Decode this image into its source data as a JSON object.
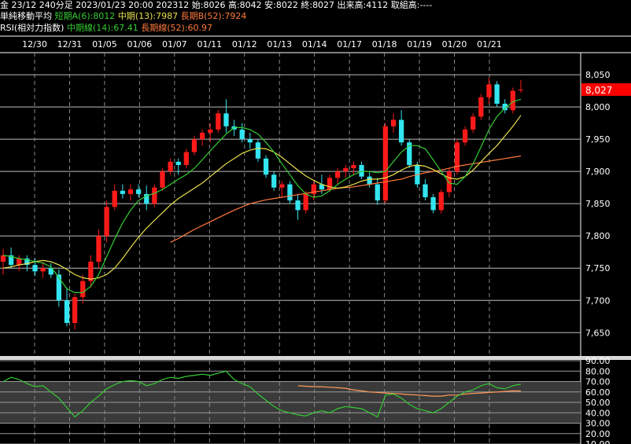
{
  "header": {
    "line1": "金 23/12 240分足 2023/01/23 20:00 202312 始:8026 高:8042 安:8022 終:8027 出来高:4112 取組高:----",
    "ma_title": "単純移動平均",
    "ma_short": "短期A(6):8012",
    "ma_mid": "中期(13):7987",
    "ma_long": "長期B(52):7924",
    "rsi_title": "RSI(相対力指数)",
    "rsi_mid": "中期線(14):67.41",
    "rsi_long": "長期線(52):60.97"
  },
  "colors": {
    "up": "#ff1a1a",
    "down": "#33e5f0",
    "ma_short": "#33cc33",
    "ma_mid": "#e8e04a",
    "ma_long": "#ff7a3c",
    "rsi_mid": "#33cc33",
    "rsi_long": "#ff9a5a",
    "price_tag": "#ff0000"
  },
  "chart_data": [
    {
      "type": "candlestick",
      "x_labels": [
        "12/30",
        "12/31",
        "01/05",
        "01/06",
        "01/07",
        "01/11",
        "01/12",
        "01/13",
        "01/14",
        "01/17",
        "01/18",
        "01/19",
        "01/20",
        "01/21"
      ],
      "y_ticks": [
        7650,
        7700,
        7750,
        7800,
        7850,
        7900,
        7950,
        8000,
        8050
      ],
      "ylim": [
        7615,
        8083
      ],
      "last_price": "8,027",
      "last_value": 8027,
      "candles": [
        [
          7760,
          7780,
          7740,
          7770
        ],
        [
          7770,
          7782,
          7750,
          7755
        ],
        [
          7755,
          7770,
          7745,
          7765
        ],
        [
          7765,
          7770,
          7745,
          7755
        ],
        [
          7755,
          7765,
          7738,
          7745
        ],
        [
          7745,
          7760,
          7735,
          7750
        ],
        [
          7750,
          7758,
          7735,
          7740
        ],
        [
          7740,
          7748,
          7690,
          7700
        ],
        [
          7700,
          7720,
          7660,
          7665
        ],
        [
          7665,
          7710,
          7655,
          7705
        ],
        [
          7705,
          7740,
          7695,
          7730
        ],
        [
          7730,
          7770,
          7720,
          7760
        ],
        [
          7760,
          7810,
          7750,
          7800
        ],
        [
          7800,
          7855,
          7790,
          7845
        ],
        [
          7845,
          7880,
          7840,
          7870
        ],
        [
          7870,
          7880,
          7858,
          7865
        ],
        [
          7865,
          7880,
          7855,
          7872
        ],
        [
          7872,
          7880,
          7860,
          7865
        ],
        [
          7865,
          7878,
          7840,
          7850
        ],
        [
          7850,
          7880,
          7845,
          7875
        ],
        [
          7875,
          7905,
          7870,
          7900
        ],
        [
          7900,
          7920,
          7895,
          7915
        ],
        [
          7915,
          7920,
          7895,
          7910
        ],
        [
          7910,
          7935,
          7905,
          7930
        ],
        [
          7930,
          7955,
          7925,
          7950
        ],
        [
          7950,
          7965,
          7940,
          7960
        ],
        [
          7960,
          7975,
          7945,
          7965
        ],
        [
          7965,
          7995,
          7960,
          7990
        ],
        [
          7990,
          8012,
          7960,
          7970
        ],
        [
          7970,
          7980,
          7955,
          7965
        ],
        [
          7965,
          7975,
          7945,
          7950
        ],
        [
          7950,
          7960,
          7935,
          7945
        ],
        [
          7945,
          7950,
          7915,
          7920
        ],
        [
          7920,
          7925,
          7890,
          7895
        ],
        [
          7895,
          7900,
          7870,
          7875
        ],
        [
          7875,
          7885,
          7860,
          7880
        ],
        [
          7880,
          7885,
          7850,
          7855
        ],
        [
          7855,
          7865,
          7825,
          7840
        ],
        [
          7840,
          7870,
          7835,
          7865
        ],
        [
          7865,
          7885,
          7855,
          7880
        ],
        [
          7880,
          7895,
          7865,
          7872
        ],
        [
          7872,
          7895,
          7868,
          7890
        ],
        [
          7890,
          7905,
          7880,
          7900
        ],
        [
          7900,
          7910,
          7890,
          7905
        ],
        [
          7905,
          7915,
          7895,
          7910
        ],
        [
          7910,
          7915,
          7888,
          7892
        ],
        [
          7892,
          7900,
          7875,
          7880
        ],
        [
          7880,
          7890,
          7848,
          7855
        ],
        [
          7855,
          7975,
          7850,
          7970
        ],
        [
          7970,
          7990,
          7960,
          7980
        ],
        [
          7980,
          7995,
          7940,
          7945
        ],
        [
          7945,
          7950,
          7905,
          7910
        ],
        [
          7910,
          7915,
          7875,
          7880
        ],
        [
          7880,
          7888,
          7855,
          7860
        ],
        [
          7860,
          7865,
          7835,
          7840
        ],
        [
          7840,
          7872,
          7835,
          7868
        ],
        [
          7868,
          7905,
          7860,
          7900
        ],
        [
          7900,
          7950,
          7895,
          7945
        ],
        [
          7945,
          7970,
          7940,
          7965
        ],
        [
          7965,
          7990,
          7960,
          7985
        ],
        [
          7985,
          8020,
          7980,
          8015
        ],
        [
          8015,
          8045,
          8005,
          8035
        ],
        [
          8035,
          8040,
          8000,
          8005
        ],
        [
          8005,
          8012,
          7990,
          7995
        ],
        [
          7995,
          8030,
          7990,
          8025
        ],
        [
          8026,
          8042,
          8022,
          8027
        ]
      ],
      "ma_short": [
        7770,
        7768,
        7765,
        7763,
        7760,
        7758,
        7752,
        7735,
        7718,
        7712,
        7712,
        7722,
        7740,
        7768,
        7795,
        7820,
        7840,
        7855,
        7862,
        7866,
        7872,
        7880,
        7888,
        7895,
        7905,
        7918,
        7932,
        7945,
        7958,
        7968,
        7968,
        7965,
        7958,
        7945,
        7930,
        7912,
        7895,
        7878,
        7865,
        7860,
        7862,
        7870,
        7880,
        7888,
        7895,
        7900,
        7900,
        7898,
        7900,
        7915,
        7930,
        7940,
        7940,
        7935,
        7918,
        7900,
        7882,
        7880,
        7892,
        7912,
        7938,
        7965,
        7985,
        7998,
        8008,
        8012
      ],
      "ma_mid": [
        7750,
        7752,
        7755,
        7757,
        7760,
        7762,
        7760,
        7755,
        7748,
        7740,
        7735,
        7733,
        7735,
        7740,
        7750,
        7765,
        7782,
        7798,
        7812,
        7824,
        7836,
        7848,
        7858,
        7866,
        7874,
        7882,
        7892,
        7902,
        7912,
        7920,
        7928,
        7933,
        7936,
        7935,
        7930,
        7922,
        7912,
        7902,
        7893,
        7886,
        7880,
        7876,
        7874,
        7876,
        7880,
        7885,
        7888,
        7888,
        7890,
        7895,
        7902,
        7908,
        7910,
        7908,
        7903,
        7896,
        7890,
        7888,
        7892,
        7902,
        7915,
        7928,
        7940,
        7955,
        7970,
        7987
      ],
      "ma_long": [
        7790,
        7796,
        7803,
        7810,
        7816,
        7822,
        7828,
        7834,
        7840,
        7845,
        7850,
        7853,
        7856,
        7858,
        7860,
        7862,
        7864,
        7866,
        7868,
        7870,
        7872,
        7874,
        7875,
        7876,
        7878,
        7880,
        7882,
        7884,
        7886,
        7888,
        7892,
        7895,
        7898,
        7900,
        7902,
        7905,
        7908,
        7910,
        7912,
        7914,
        7916,
        7918,
        7920,
        7922,
        7924
      ],
      "ma_long_start_index": 21
    },
    {
      "type": "line",
      "name": "RSI",
      "y_ticks": [
        10,
        20,
        30,
        40,
        50,
        60,
        70,
        80,
        90
      ],
      "y_tick_labels": [
        "10.00",
        "20.00",
        "30.00",
        "40.00",
        "50.00",
        "60.00",
        "70.00",
        "80.00",
        "90.00"
      ],
      "ylim": [
        10,
        90
      ],
      "bands": [
        [
          30,
          70
        ]
      ],
      "rsi_mid": [
        70,
        74,
        72,
        68,
        65,
        66,
        60,
        54,
        45,
        36,
        42,
        50,
        56,
        63,
        67,
        70,
        71,
        70,
        66,
        68,
        72,
        74,
        73,
        75,
        76,
        77,
        76,
        78,
        80,
        72,
        68,
        65,
        58,
        52,
        46,
        42,
        40,
        38,
        37,
        40,
        42,
        40,
        44,
        46,
        45,
        44,
        40,
        36,
        57,
        58,
        54,
        48,
        44,
        42,
        40,
        44,
        50,
        56,
        60,
        62,
        66,
        68,
        64,
        63,
        66,
        67.41
      ],
      "rsi_long": [
        66,
        65.5,
        65,
        65,
        64.5,
        64,
        63.5,
        62,
        61,
        60,
        59.5,
        59,
        58.5,
        58,
        57.5,
        57,
        56.5,
        56,
        56,
        57,
        57,
        58,
        58.5,
        59,
        59.5,
        60,
        60.5,
        61,
        60.97
      ],
      "rsi_long_start_index": 37
    }
  ]
}
